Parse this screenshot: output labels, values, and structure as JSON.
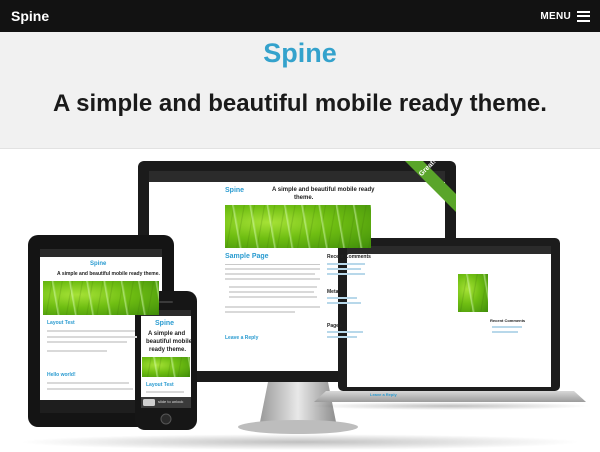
{
  "header": {
    "brand": "Spine",
    "menu_label": "MENU"
  },
  "hero": {
    "title": "Spine",
    "tagline": "A simple and beautiful mobile ready theme."
  },
  "showcase": {
    "ribbon": "Great!",
    "monitor": {
      "site_title": "Spine",
      "tagline_line1": "A simple and beautiful mobile ready",
      "tagline_line2": "theme.",
      "page_heading": "Sample Page",
      "leave_reply": "Leave a Reply",
      "sidebar_recent": "Recent Comments",
      "sidebar_meta": "Meta",
      "sidebar_pages": "Pages"
    },
    "laptop": {
      "widget": "Recent Comments",
      "leave_reply": "Leave a Reply"
    },
    "tablet": {
      "site_title": "Spine",
      "tagline": "A simple and beautiful mobile ready theme.",
      "post_title": "Layout Test",
      "post2_title": "Hello world!"
    },
    "phone": {
      "site_title": "Spine",
      "tagline_line1": "A simple and",
      "tagline_line2": "beautiful mobile",
      "tagline_line3": "ready theme.",
      "post_title": "Layout Test",
      "unlock": "slide to unlock"
    }
  },
  "colors": {
    "accent": "#34a2cc",
    "topbar": "#121212",
    "hero_bg": "#f1f1f1",
    "ribbon": "#5aa52a"
  }
}
